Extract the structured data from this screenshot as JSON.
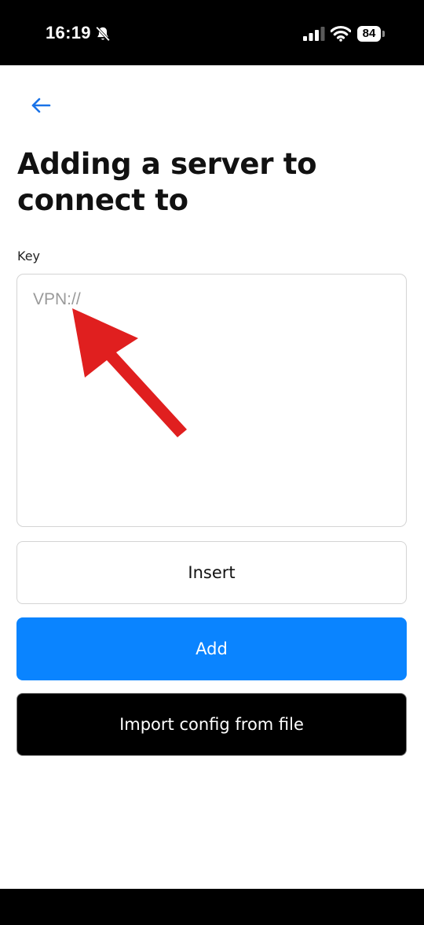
{
  "status_bar": {
    "time": "16:19",
    "battery_level": "84",
    "icons": [
      "bell-slash-icon",
      "cellular-signal-icon",
      "wifi-icon",
      "battery-icon"
    ]
  },
  "header": {
    "back_icon": "arrow-left-icon",
    "title": "Adding a server to connect to"
  },
  "form": {
    "key_label": "Key",
    "key_input": {
      "value": "",
      "placeholder": "VPN://"
    },
    "insert_label": "Insert",
    "add_label": "Add",
    "import_label": "Import config from file"
  },
  "colors": {
    "accent": "#0a84ff",
    "import_button": "#000000",
    "annotation_arrow": "#e01f1f"
  }
}
